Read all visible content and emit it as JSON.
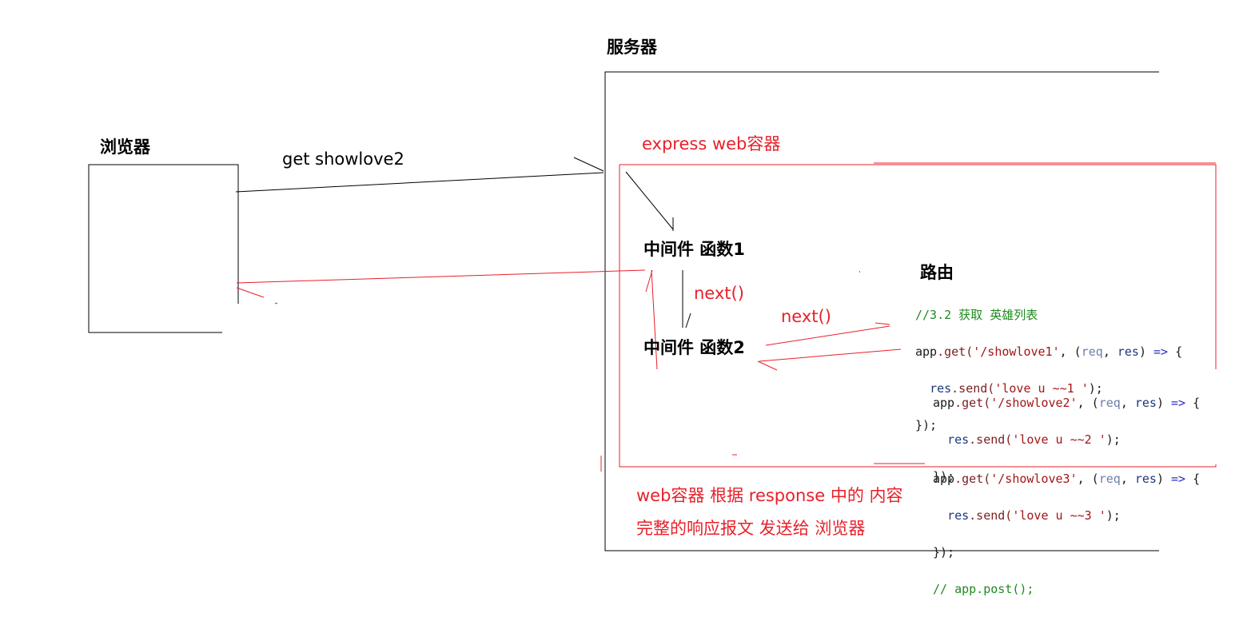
{
  "labels": {
    "browser": "浏览器",
    "server": "服务器",
    "request": "get showlove2",
    "container": "express web容器",
    "middleware1": "中间件 函数1",
    "middleware2": "中间件 函数2",
    "next1": "next()",
    "next2": "next()",
    "routing": "路由",
    "response_line1": "web容器 根据 response 中的 内容",
    "response_line2": "完整的响应报文 发送给 浏览器"
  },
  "code": {
    "comment": "//3.2 获取 英雄列表",
    "route1": {
      "app": "app",
      "get": ".get(",
      "path": "'/showlove1'",
      "sep": ", (",
      "req": "req",
      "comma": ", ",
      "res": "res",
      "close": ") ",
      "arrow": "=>",
      "brace": " {",
      "send_res": "res",
      "send_fn": ".send(",
      "send_str": "'love u ~~1 '",
      "send_end": ");",
      "end": "});"
    },
    "route2": {
      "app": "app",
      "get": ".get(",
      "path": "'/showlove2'",
      "sep": ", (",
      "req": "req",
      "comma": ", ",
      "res": "res",
      "close": ") ",
      "arrow": "=>",
      "brace": " {",
      "send_res": "res",
      "send_fn": ".send(",
      "send_str": "'love u ~~2 '",
      "send_end": ");",
      "end": "});"
    },
    "route3": {
      "app": "app",
      "get": ".get(",
      "path": "'/showlove3'",
      "sep": ", (",
      "req": "req",
      "comma": ", ",
      "res": "res",
      "close": ") ",
      "arrow": "=>",
      "brace": " {",
      "send_res": "res",
      "send_fn": ".send(",
      "send_str": "'love u ~~3 '",
      "send_end": ");",
      "end": "});"
    },
    "post_comment": "// app.post();"
  },
  "colors": {
    "annotation_red": "#e8202a",
    "line_black": "#000000",
    "comment_green": "#1e8a1e"
  }
}
